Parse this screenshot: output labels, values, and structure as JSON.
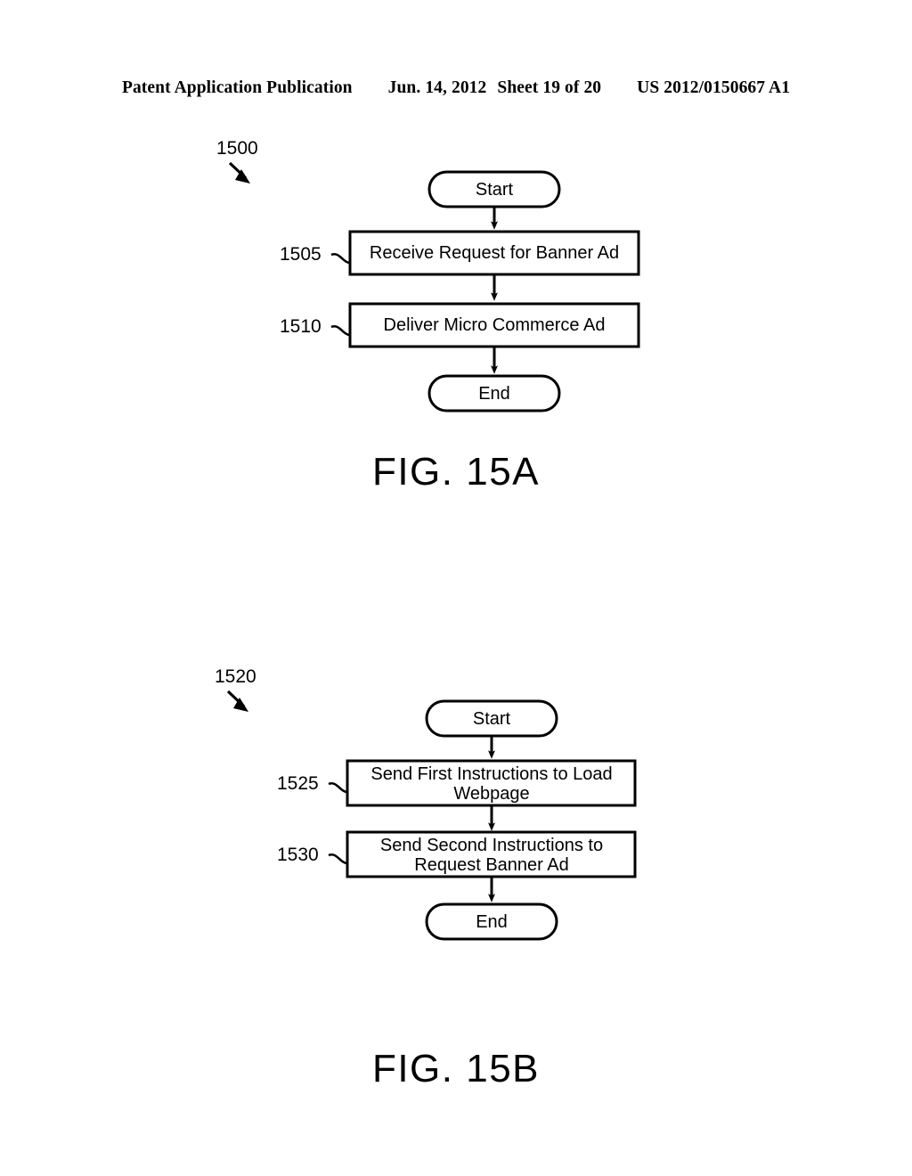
{
  "header": {
    "publication": "Patent Application Publication",
    "date": "Jun. 14, 2012",
    "sheet": "Sheet 19 of 20",
    "patent_number": "US 2012/0150667 A1"
  },
  "figures": [
    {
      "caption": "FIG. 15A",
      "diagram_ref": "1500",
      "nodes": [
        {
          "id": "start",
          "type": "terminator",
          "label": "Start",
          "ref": ""
        },
        {
          "id": "step1505",
          "type": "process",
          "label": "Receive Request for Banner Ad",
          "ref": "1505"
        },
        {
          "id": "step1510",
          "type": "process",
          "label": "Deliver Micro Commerce Ad",
          "ref": "1510"
        },
        {
          "id": "end",
          "type": "terminator",
          "label": "End",
          "ref": ""
        }
      ]
    },
    {
      "caption": "FIG. 15B",
      "diagram_ref": "1520",
      "nodes": [
        {
          "id": "start",
          "type": "terminator",
          "label": "Start",
          "ref": ""
        },
        {
          "id": "step1525",
          "type": "process",
          "label_line1": "Send First Instructions to Load",
          "label_line2": "Webpage",
          "ref": "1525"
        },
        {
          "id": "step1530",
          "type": "process",
          "label_line1": "Send Second Instructions to",
          "label_line2": "Request Banner Ad",
          "ref": "1530"
        },
        {
          "id": "end",
          "type": "terminator",
          "label": "End",
          "ref": ""
        }
      ]
    }
  ],
  "colors": {
    "ink": "#000000",
    "paper": "#ffffff"
  }
}
